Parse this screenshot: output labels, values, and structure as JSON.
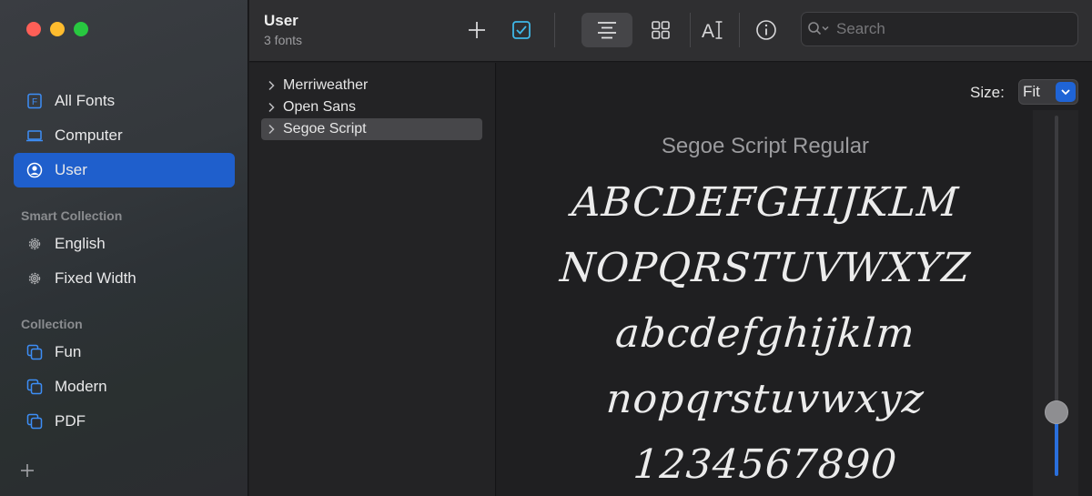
{
  "sidebar": {
    "items": [
      {
        "label": "All Fonts",
        "icon": "font-box-icon"
      },
      {
        "label": "Computer",
        "icon": "laptop-icon"
      },
      {
        "label": "User",
        "icon": "user-circle-icon"
      }
    ],
    "smart_collection": {
      "heading": "Smart Collection",
      "items": [
        {
          "label": "English",
          "icon": "gear-icon"
        },
        {
          "label": "Fixed Width",
          "icon": "gear-icon"
        }
      ]
    },
    "collection": {
      "heading": "Collection",
      "items": [
        {
          "label": "Fun",
          "icon": "collection-icon"
        },
        {
          "label": "Modern",
          "icon": "collection-icon"
        },
        {
          "label": "PDF",
          "icon": "collection-icon"
        }
      ]
    },
    "add_icon": "plus-icon"
  },
  "toolbar": {
    "title": "User",
    "subtitle": "3 fonts",
    "search_placeholder": "Search"
  },
  "font_list": [
    {
      "name": "Merriweather",
      "selected": false
    },
    {
      "name": "Open Sans",
      "selected": false
    },
    {
      "name": "Segoe Script",
      "selected": true
    }
  ],
  "preview": {
    "size_label": "Size:",
    "size_value": "Fit",
    "font_name": "Segoe Script Regular",
    "lines": [
      "ABCDEFGHIJKLM",
      "NOPQRSTUVWXYZ",
      "abcdefghijklm",
      "nopqrstuvwxyz",
      "1234567890"
    ],
    "slider_fraction": 0.16
  },
  "colors": {
    "accent": "#1f5fcc",
    "close": "#fe5f57",
    "minimize": "#febc2e",
    "zoom": "#28c840"
  }
}
